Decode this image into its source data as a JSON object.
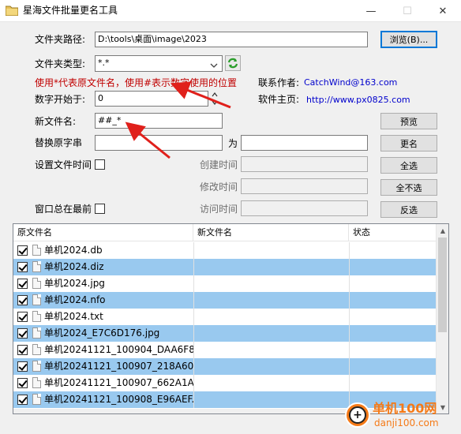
{
  "window": {
    "title": "星海文件批量更名工具",
    "minimize": "—",
    "maximize": "☐",
    "close": "✕"
  },
  "form": {
    "folder_path_label": "文件夹路径:",
    "folder_path_value": "D:\\tools\\桌面\\image\\2023",
    "browse_button": "浏览(B)...",
    "folder_type_label": "文件夹类型:",
    "folder_type_value": "*.*",
    "hint": "使用*代表原文件名，使用#表示数字使用的位置",
    "contact_label": "联系作者:",
    "contact_value": "CatchWind@163.com",
    "start_num_label": "数字开始于:",
    "start_num_value": "0",
    "homepage_label": "软件主页:",
    "homepage_value": "http://www.px0825.com",
    "new_name_label": "新文件名:",
    "new_name_value": "##_*",
    "preview_button": "预览",
    "replace_label": "替换原字串",
    "replace_to_label": "为",
    "rename_button": "更名",
    "set_time_label": "设置文件时间",
    "create_time_label": "创建时间",
    "select_all_button": "全选",
    "modify_time_label": "修改时间",
    "deselect_all_button": "全不选",
    "topmost_label": "窗口总在最前",
    "access_time_label": "访问时间",
    "invert_button": "反选"
  },
  "list": {
    "columns": [
      "原文件名",
      "新文件名",
      "状态"
    ],
    "rows": [
      {
        "name": "单机2024.db",
        "selected": false
      },
      {
        "name": "单机2024.diz",
        "selected": true
      },
      {
        "name": "单机2024.jpg",
        "selected": false
      },
      {
        "name": "单机2024.nfo",
        "selected": true
      },
      {
        "name": "单机2024.txt",
        "selected": false
      },
      {
        "name": "单机2024_E7C6D176.jpg",
        "selected": true
      },
      {
        "name": "单机20241121_100904_DAA6F8...",
        "selected": false
      },
      {
        "name": "单机20241121_100907_218A60...",
        "selected": true
      },
      {
        "name": "单机20241121_100907_662A1A...",
        "selected": false
      },
      {
        "name": "单机20241121_100908_E96AEF...",
        "selected": true
      }
    ]
  },
  "watermark": {
    "line1": "单机100网",
    "line2": "danji100.com"
  },
  "colors": {
    "selection": "#99c9ef",
    "hint": "#c00000",
    "link": "#0000cc",
    "arrow": "#e0201b"
  }
}
